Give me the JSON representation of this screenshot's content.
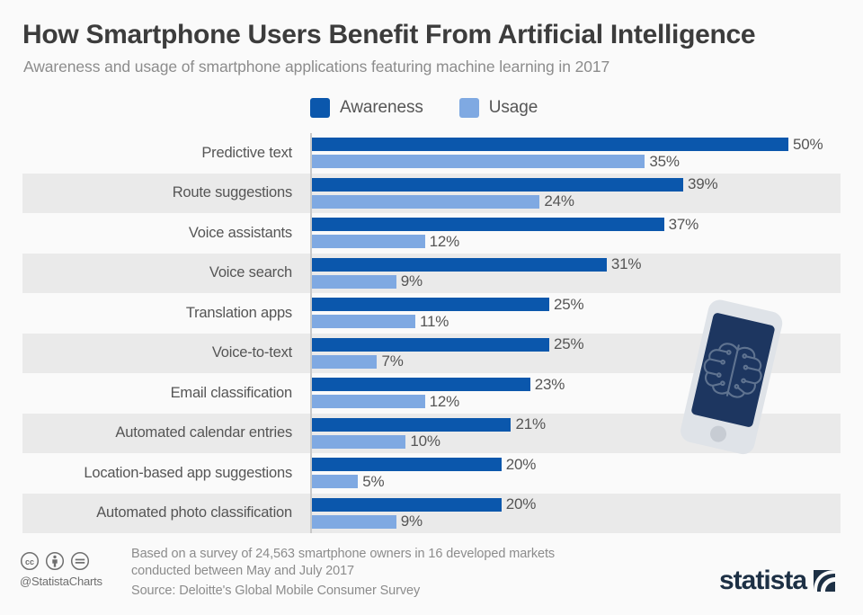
{
  "header": {
    "title": "How Smartphone Users Benefit From Artificial Intelligence",
    "subtitle": "Awareness and usage of smartphone applications featuring machine learning in 2017"
  },
  "legend": {
    "items": [
      {
        "label": "Awareness",
        "color": "#0b57ac"
      },
      {
        "label": "Usage",
        "color": "#7fa9e2"
      }
    ]
  },
  "footer": {
    "note": "Based on a survey of 24,563 smartphone owners in 16 developed markets conducted between May and July 2017",
    "source": "Source: Deloitte's Global Mobile Consumer Survey",
    "handle": "@StatistaCharts",
    "cc_icons": [
      "creative-commons-icon",
      "attribution-person-icon",
      "no-derivatives-equals-icon"
    ],
    "brand": "statista"
  },
  "illustration": {
    "name": "smartphone-with-brain-icon",
    "body_color": "#dfe3e8",
    "screen_color": "#1d3660",
    "brain_color": "#5f7390"
  },
  "colors": {
    "background": "#fafafa",
    "row_band": "#eaeaea",
    "axis": "#c9c9c9",
    "text": "#555555",
    "title": "#3c3c3c",
    "muted": "#8c8c8c"
  },
  "chart_data": {
    "type": "bar",
    "orientation": "horizontal",
    "title": "How Smartphone Users Benefit From Artificial Intelligence",
    "subtitle": "Awareness and usage of smartphone applications featuring machine learning in 2017",
    "xlabel": "",
    "ylabel": "",
    "unit": "%",
    "xlim": [
      0,
      50
    ],
    "grid": false,
    "legend_position": "top-center",
    "categories": [
      "Predictive text",
      "Route suggestions",
      "Voice assistants",
      "Voice search",
      "Translation apps",
      "Voice-to-text",
      "Email classification",
      "Automated calendar entries",
      "Location-based app suggestions",
      "Automated photo classification"
    ],
    "series": [
      {
        "name": "Awareness",
        "color": "#0b57ac",
        "values": [
          50,
          39,
          37,
          31,
          25,
          25,
          23,
          21,
          20,
          20
        ],
        "labels": [
          "50%",
          "39%",
          "37%",
          "31%",
          "25%",
          "25%",
          "23%",
          "21%",
          "20%",
          "20%"
        ]
      },
      {
        "name": "Usage",
        "color": "#7fa9e2",
        "values": [
          35,
          24,
          12,
          9,
          11,
          7,
          12,
          10,
          5,
          9
        ],
        "labels": [
          "35%",
          "24%",
          "12%",
          "9%",
          "11%",
          "7%",
          "12%",
          "10%",
          "5%",
          "9%"
        ]
      }
    ]
  }
}
